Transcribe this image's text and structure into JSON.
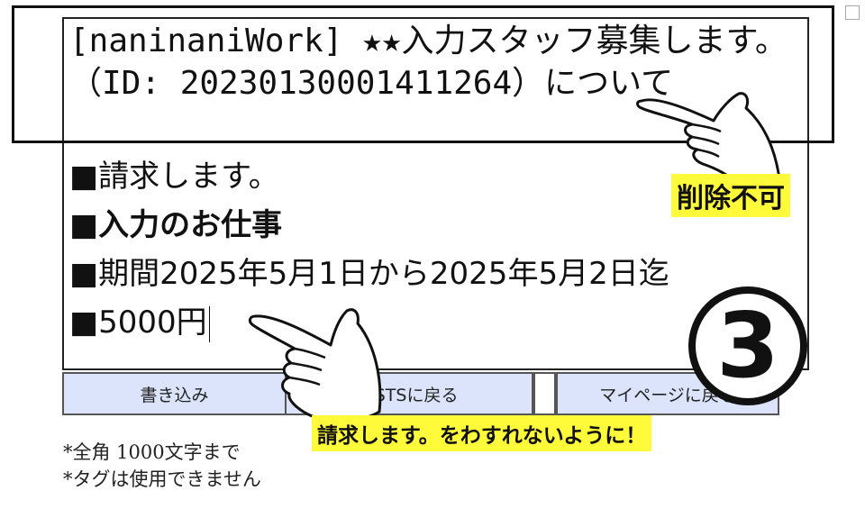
{
  "compose": {
    "subject_text": "[naninaniWork] ★★入力スタッフ募集します。（ID: 20230130001411264）について",
    "body_lines": [
      "■請求します。",
      "■入力のお仕事",
      "■期間2025年5月1日から2025年5月2日迄",
      "■5000円"
    ]
  },
  "buttons": {
    "write": "書き込み",
    "lists": "LISTSに戻る",
    "mypage": "マイページに戻る"
  },
  "notes": [
    "*全角 1000文字まで",
    "*タグは使用できません"
  ],
  "annotations": {
    "cannot_delete": "削除不可",
    "remind": "請求します。をわすれないように！",
    "step_number": "③"
  },
  "colors": {
    "button_bg": "#dbe4fb",
    "label_bg": "#fffb3b"
  }
}
